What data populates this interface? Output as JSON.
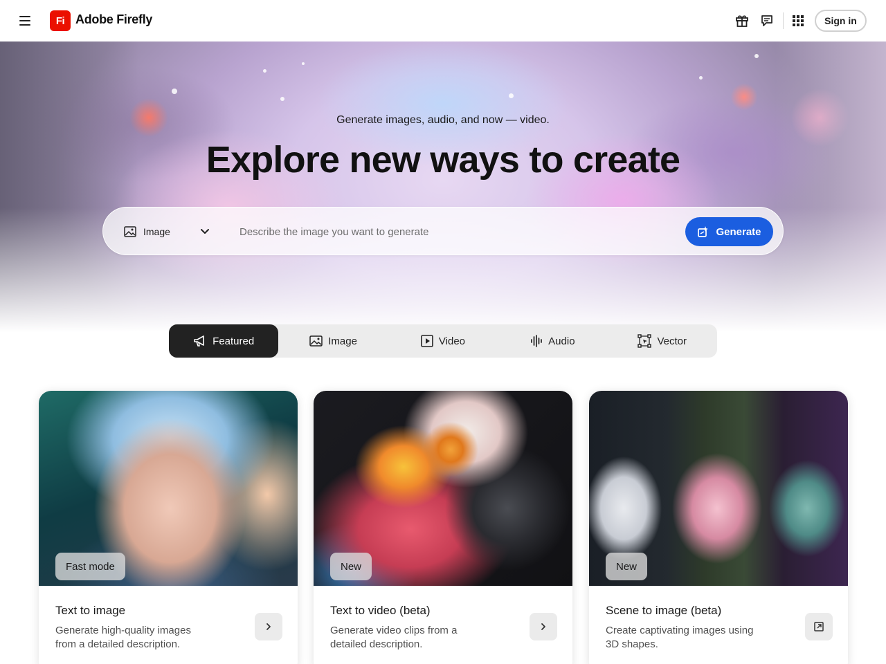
{
  "header": {
    "brand_logo_text": "Fi",
    "brand_name": "Adobe Firefly",
    "sign_in_label": "Sign in",
    "icons": [
      "menu-icon",
      "gift-icon",
      "feedback-icon",
      "app-switcher-icon"
    ]
  },
  "hero": {
    "subtitle": "Generate images, audio, and now — video.",
    "title": "Explore new ways to create",
    "prompt": {
      "type_label": "Image",
      "placeholder": "Describe the image you want to generate",
      "value": "",
      "generate_label": "Generate"
    }
  },
  "tabs": [
    {
      "label": "Featured",
      "icon": "megaphone-icon",
      "active": true
    },
    {
      "label": "Image",
      "icon": "image-icon",
      "active": false
    },
    {
      "label": "Video",
      "icon": "video-icon",
      "active": false
    },
    {
      "label": "Audio",
      "icon": "audio-icon",
      "active": false
    },
    {
      "label": "Vector",
      "icon": "vector-icon",
      "active": false
    }
  ],
  "cards": [
    {
      "badge": "Fast mode",
      "title": "Text to image",
      "description": "Generate high-quality images from a detailed description.",
      "action_icon": "chevron-right-icon"
    },
    {
      "badge": "New",
      "title": "Text to video (beta)",
      "description": "Generate video clips from a detailed description.",
      "action_icon": "chevron-right-icon"
    },
    {
      "badge": "New",
      "title": "Scene to image (beta)",
      "description": "Create captivating images using 3D shapes.",
      "action_icon": "open-external-icon"
    }
  ],
  "colors": {
    "brand_red": "#eb1000",
    "generate_blue": "#1b5ee0",
    "active_tab": "#222222"
  }
}
